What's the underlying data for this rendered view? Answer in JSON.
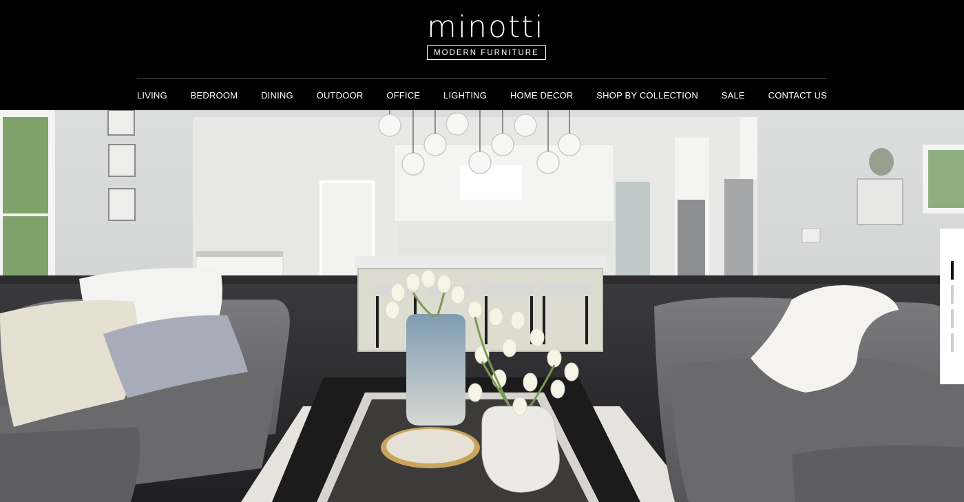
{
  "brand": {
    "name": "minotti",
    "tagline": "MODERN FURNITURE"
  },
  "nav": {
    "items": [
      {
        "label": "LIVING"
      },
      {
        "label": "BEDROOM"
      },
      {
        "label": "DINING"
      },
      {
        "label": "OUTDOOR"
      },
      {
        "label": "OFFICE"
      },
      {
        "label": "LIGHTING"
      },
      {
        "label": "HOME DECOR"
      },
      {
        "label": "SHOP BY COLLECTION"
      },
      {
        "label": "SALE"
      },
      {
        "label": "CONTACT US"
      }
    ]
  },
  "hero": {
    "slides_total": 4,
    "active_slide": 1
  },
  "colors": {
    "header_bg": "#000000",
    "text": "#ffffff",
    "wall": "#d6d8d8",
    "sofa": "#6e6e70",
    "floor": "#2a2a2c"
  }
}
